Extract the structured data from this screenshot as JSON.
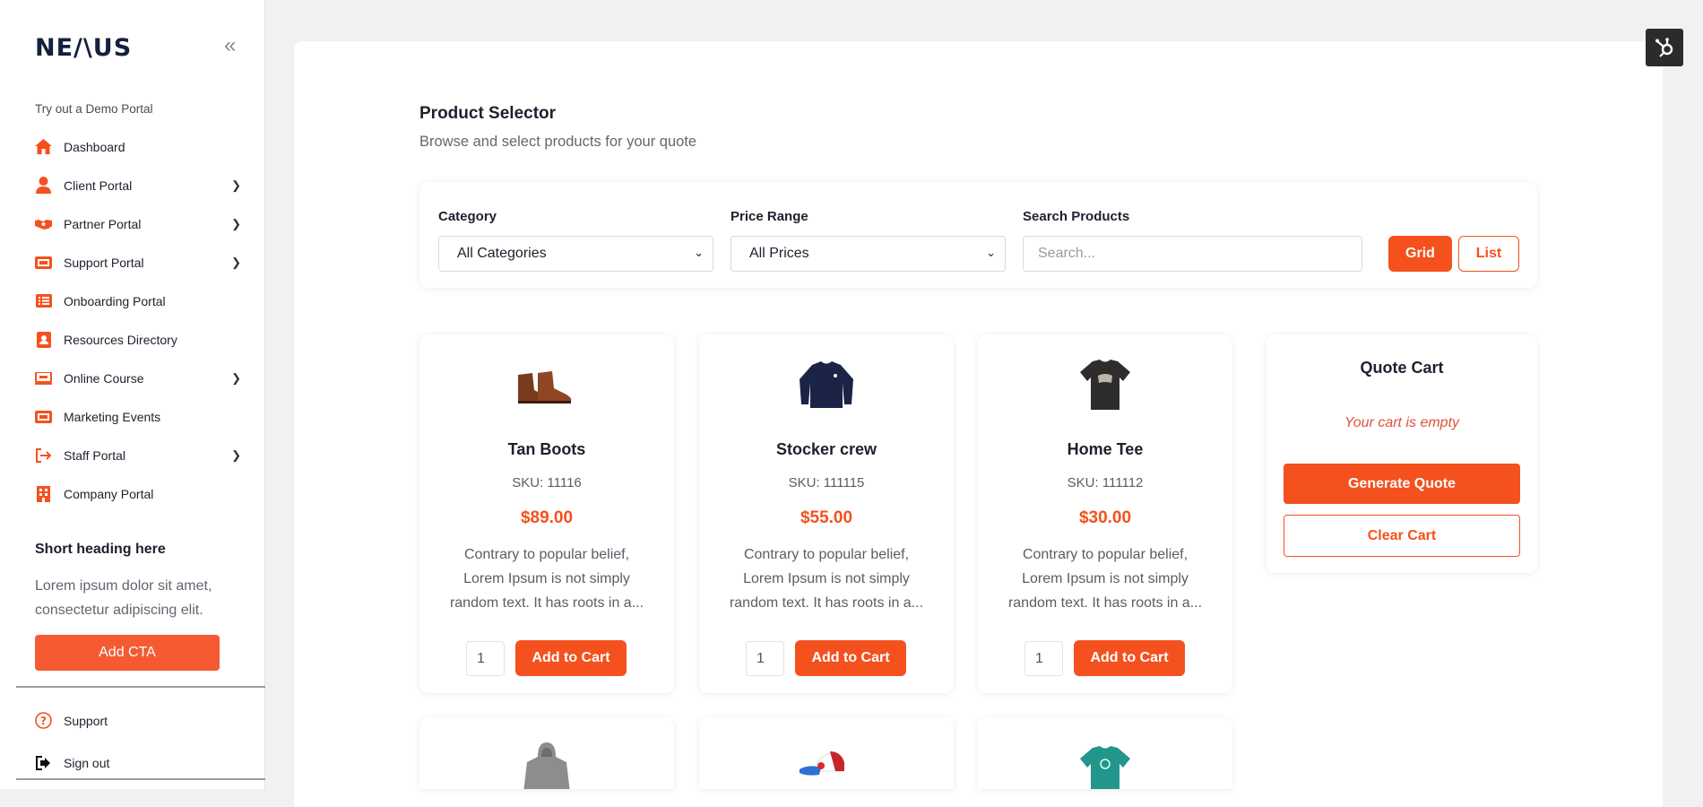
{
  "brand": {
    "logo": "NE/\\US"
  },
  "sidebar": {
    "demo_label": "Try out a Demo Portal",
    "items": [
      {
        "label": "Dashboard",
        "icon": "home-icon",
        "chevron": false
      },
      {
        "label": "Client Portal",
        "icon": "user-icon",
        "chevron": true
      },
      {
        "label": "Partner Portal",
        "icon": "handshake-icon",
        "chevron": true
      },
      {
        "label": "Support Portal",
        "icon": "ticket-icon",
        "chevron": true
      },
      {
        "label": "Onboarding Portal",
        "icon": "list-icon",
        "chevron": false
      },
      {
        "label": "Resources Directory",
        "icon": "address-book-icon",
        "chevron": false
      },
      {
        "label": "Online Course",
        "icon": "laptop-icon",
        "chevron": true
      },
      {
        "label": "Marketing Events",
        "icon": "ticket-icon",
        "chevron": false
      },
      {
        "label": "Staff Portal",
        "icon": "sign-in-icon",
        "chevron": true
      },
      {
        "label": "Company Portal",
        "icon": "building-icon",
        "chevron": false
      }
    ],
    "short_heading": "Short heading here",
    "short_text": "Lorem ipsum dolor sit amet, consectetur adipiscing elit.",
    "cta_label": "Add CTA",
    "bottom": [
      {
        "label": "Support",
        "icon": "question-icon"
      },
      {
        "label": "Sign out",
        "icon": "sign-out-icon"
      }
    ]
  },
  "page": {
    "title": "Product Selector",
    "subtitle": "Browse and select products for your quote"
  },
  "filters": {
    "category_label": "Category",
    "category_value": "All Categories",
    "price_label": "Price Range",
    "price_value": "All Prices",
    "search_label": "Search Products",
    "search_placeholder": "Search...",
    "grid_label": "Grid",
    "list_label": "List"
  },
  "products": [
    {
      "name": "Tan Boots",
      "sku": "SKU: 11116",
      "price": "$89.00",
      "desc": "Contrary to popular belief, Lorem Ipsum is not simply random text. It has roots in a...",
      "qty": "1",
      "add_label": "Add to Cart",
      "image": "boots"
    },
    {
      "name": "Stocker crew",
      "sku": "SKU: 111115",
      "price": "$55.00",
      "desc": "Contrary to popular belief, Lorem Ipsum is not simply random text. It has roots in a...",
      "qty": "1",
      "add_label": "Add to Cart",
      "image": "sweater"
    },
    {
      "name": "Home Tee",
      "sku": "SKU: 111112",
      "price": "$30.00",
      "desc": "Contrary to popular belief, Lorem Ipsum is not simply random text. It has roots in a...",
      "qty": "1",
      "add_label": "Add to Cart",
      "image": "tee"
    }
  ],
  "more_products": [
    {
      "image": "hoodie"
    },
    {
      "image": "cap"
    },
    {
      "image": "teal-tee"
    }
  ],
  "cart": {
    "title": "Quote Cart",
    "empty_text": "Your cart is empty",
    "generate_label": "Generate Quote",
    "clear_label": "Clear Cart"
  },
  "colors": {
    "accent": "#f4511e",
    "brand_dark": "#14213d"
  }
}
